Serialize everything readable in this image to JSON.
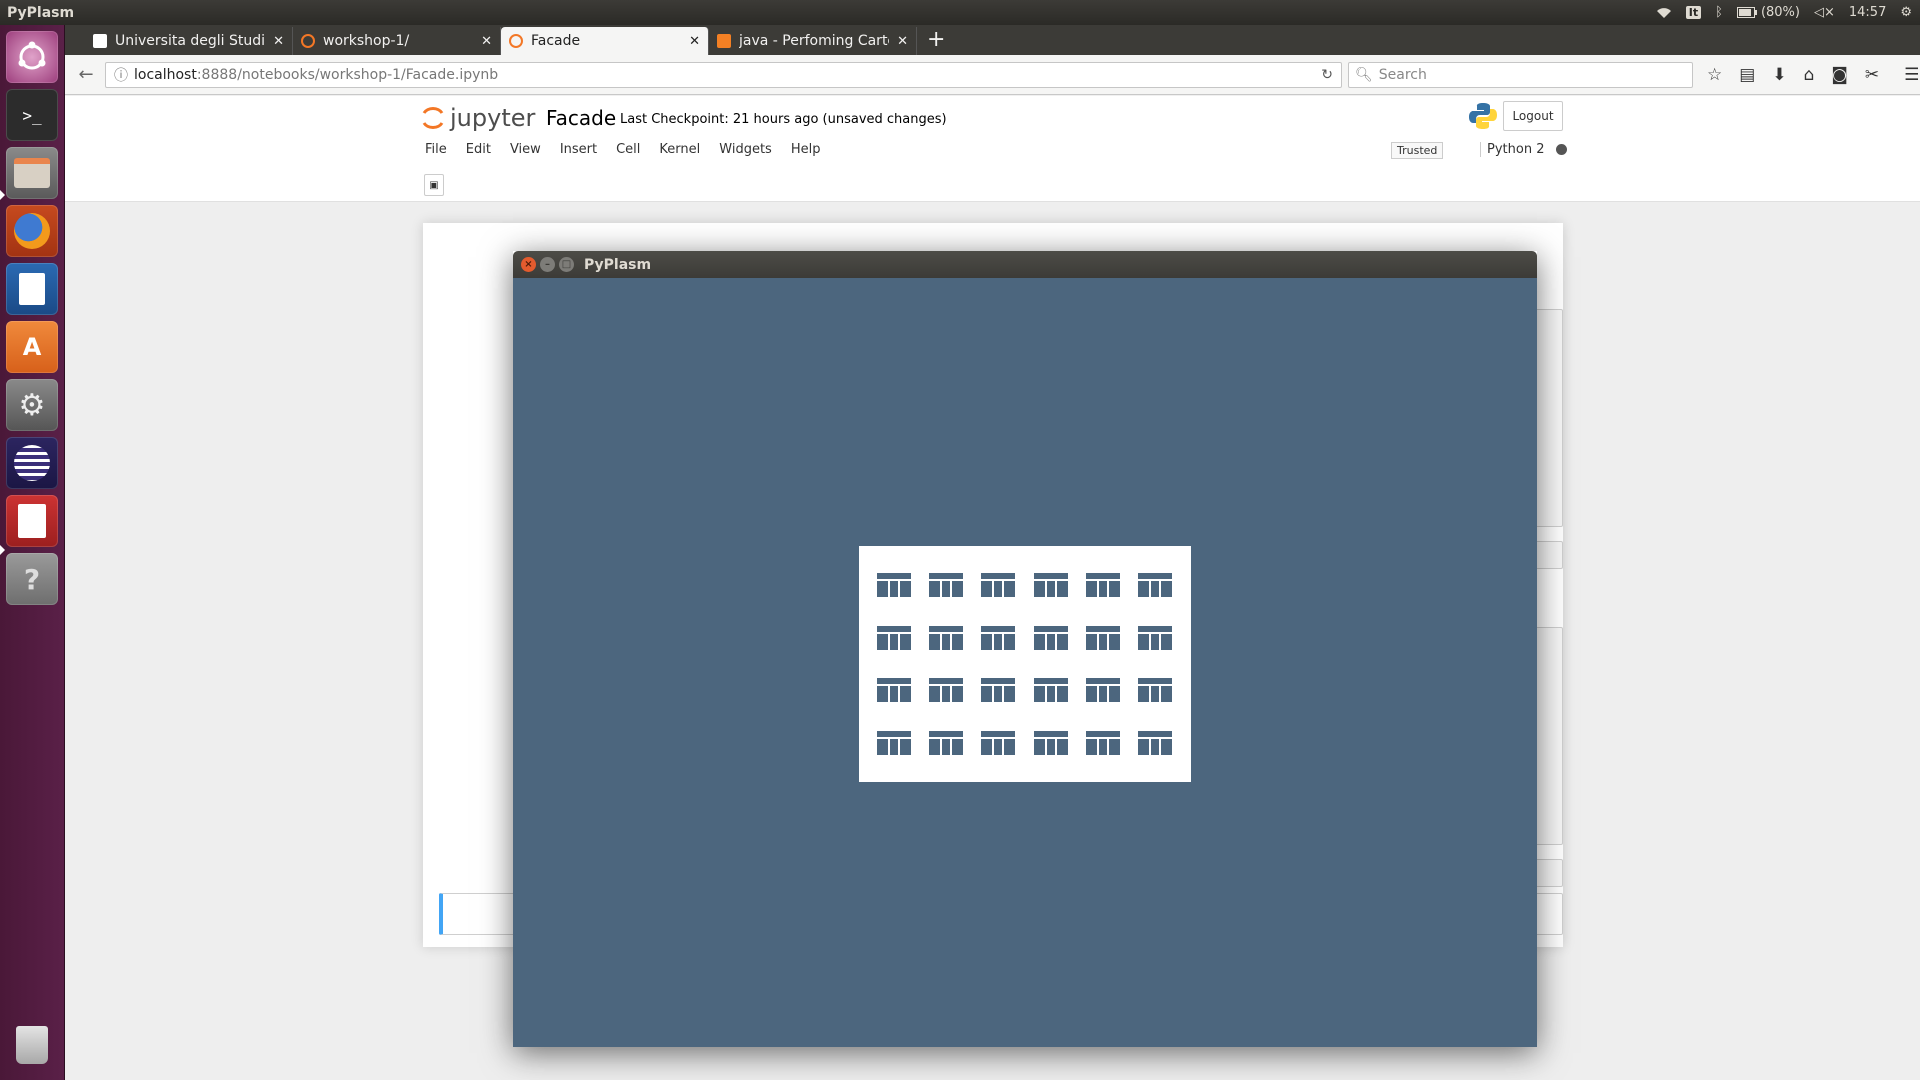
{
  "top_panel": {
    "app_title": "PyPlasm",
    "keyboard_layout": "It",
    "battery": "(80%)",
    "time": "14:57"
  },
  "launcher": {
    "items": [
      {
        "name": "ubuntu-dash",
        "icon": "ubuntu-logo-icon"
      },
      {
        "name": "terminal",
        "icon": "terminal-icon"
      },
      {
        "name": "files",
        "icon": "file-manager-icon"
      },
      {
        "name": "firefox",
        "icon": "firefox-icon"
      },
      {
        "name": "writer",
        "icon": "libreoffice-writer-icon"
      },
      {
        "name": "software-center",
        "icon": "software-center-icon"
      },
      {
        "name": "system-settings",
        "icon": "settings-icon"
      },
      {
        "name": "eclipse",
        "icon": "eclipse-icon"
      },
      {
        "name": "pdf-viewer",
        "icon": "pdf-viewer-icon"
      },
      {
        "name": "help",
        "icon": "help-icon"
      },
      {
        "name": "trash",
        "icon": "trash-icon"
      }
    ]
  },
  "browser": {
    "tabs": [
      {
        "label": "Universita degli Studi R",
        "active": false
      },
      {
        "label": "workshop-1/",
        "active": false
      },
      {
        "label": "Facade",
        "active": true
      },
      {
        "label": "java - Perfoming Carte",
        "active": false
      }
    ],
    "url_host": "localhost",
    "url_path": ":8888/notebooks/workshop-1/Facade.ipynb",
    "search_placeholder": "Search"
  },
  "jupyter": {
    "logo_text": "jupyter",
    "notebook_name": "Facade",
    "checkpoint": "Last Checkpoint: 21 hours ago (unsaved changes)",
    "logout_label": "Logout",
    "menu": [
      "File",
      "Edit",
      "View",
      "Insert",
      "Cell",
      "Kernel",
      "Widgets",
      "Help"
    ],
    "trusted_label": "Trusted",
    "kernel_name": "Python 2"
  },
  "pyplasm_window": {
    "title": "PyPlasm",
    "background_color": "#4c667e",
    "facade": {
      "rows": 4,
      "columns": 6,
      "wall_color": "#ffffff",
      "window_color": "#4c667e"
    }
  }
}
